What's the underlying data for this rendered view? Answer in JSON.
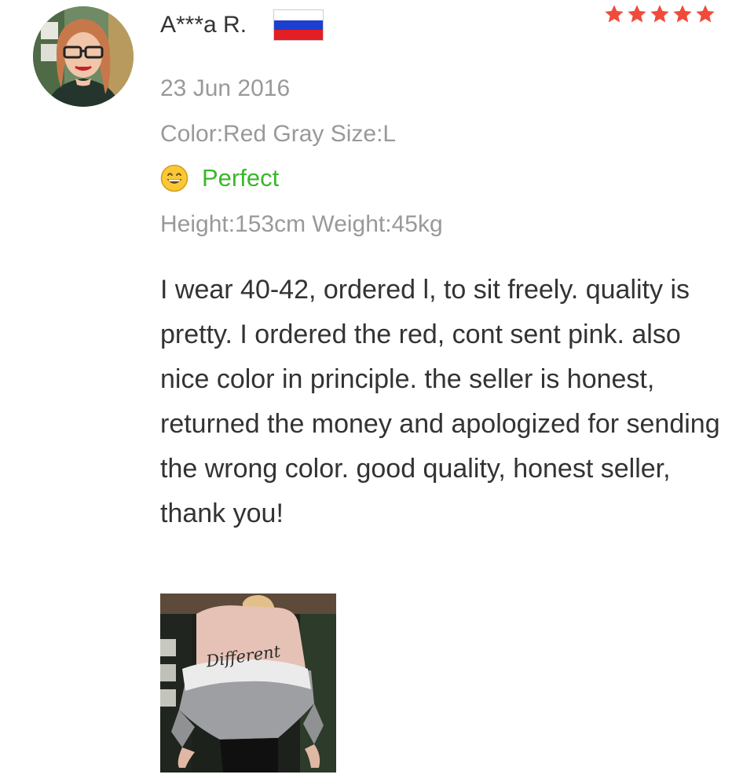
{
  "review": {
    "reviewer_name": "A***a R.",
    "country_flag": "russia-flag-icon",
    "rating": 5,
    "star_color": "#f04b3a",
    "date": "23 Jun 2016",
    "sku": "Color:Red Gray Size:L",
    "fit_icon": "smiling-face-icon",
    "fit_label": "Perfect",
    "fit_color": "#3bb72b",
    "body_info": "Height:153cm Weight:45kg",
    "text": "I wear 40-42, ordered l, to sit freely. quality is pretty. I ordered the red, cont sent pink. also nice color in principle. the seller is honest, returned the money and apologized for sending the wrong color. good quality, honest seller, thank you!",
    "photo_icon": "review-photo-thumbnail",
    "photo_print": "Different"
  }
}
